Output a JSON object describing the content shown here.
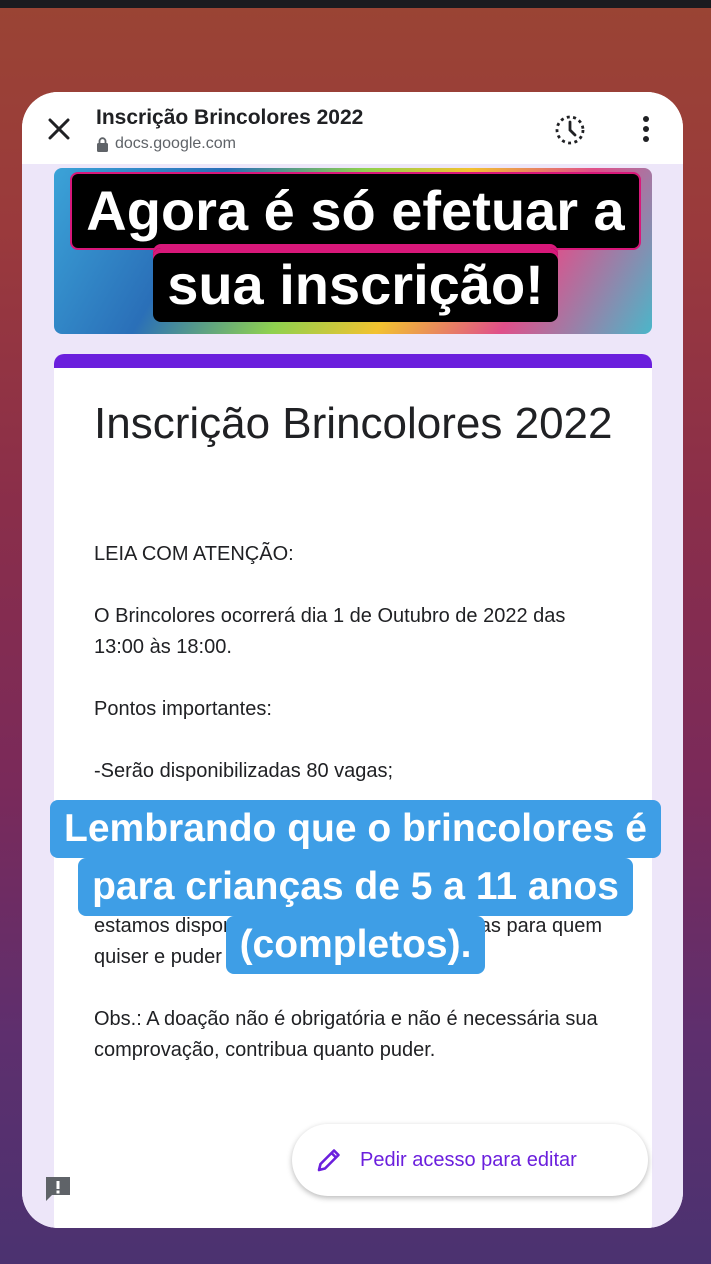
{
  "browser": {
    "page_title": "Inscrição Brincolores 2022",
    "url": "docs.google.com",
    "icons": {
      "close": "close-icon",
      "lock": "lock-icon",
      "history": "history-icon",
      "menu": "more-vert-icon"
    }
  },
  "form": {
    "title": "Inscrição Brincolores 2022",
    "description": [
      "LEIA COM ATENÇÃO:",
      "",
      "O Brincolores ocorrerá dia 1 de Outubro  de 2022 das 13:00 às 18:00.",
      "",
      "Pontos importantes:",
      "",
      "-Serão disponibilizadas 80 vagas;",
      "",
      "",
      "Este ano novamente não haverá taxa de inscrição de valor fixo, porém a casa está precisando de manutenção, estamos disponibilizando as contas bancárias para quem quiser e puder realizar uma doação.",
      "",
      "Obs.: A doação não é obrigatória e não é necessária sua comprovação, contribua quanto puder."
    ],
    "accent_color": "#6b1fdd",
    "background_color": "#ede6f9"
  },
  "edit_button": {
    "label": "Pedir acesso para editar",
    "icon": "pencil-icon"
  },
  "feedback_icon": "feedback-icon",
  "story_captions": {
    "top": [
      "Agora é só efetuar a",
      "sua inscrição!"
    ],
    "middle": [
      "Lembrando que o brincolores é",
      "para crianças de 5 a 11 anos",
      "(completos)."
    ]
  },
  "colors": {
    "caption_top_bg": "#000000",
    "caption_top_border": "#d8187a",
    "caption_middle_bg": "#3e9ee6"
  }
}
